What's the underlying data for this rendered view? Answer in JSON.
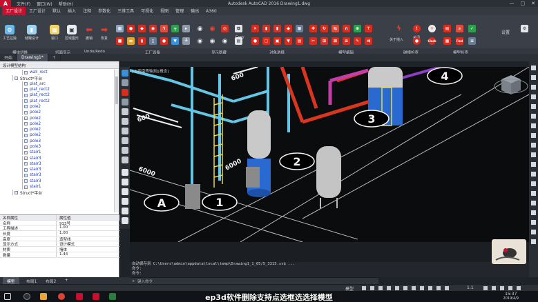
{
  "titlebar": {
    "logo": "A",
    "menus": [
      "文件(F)",
      "窗口(W)",
      "帮助(H)"
    ],
    "title": "Autodesk AutoCAD 2016   Drawing1.dwg",
    "controls": [
      "—",
      "□",
      "✕"
    ]
  },
  "ribbon_tabs": [
    "工厂设计",
    "工厂设计",
    "默认",
    "插入",
    "注释",
    "参数化",
    "三维工具",
    "可视化",
    "视图",
    "管理",
    "输出",
    "A360"
  ],
  "ribbon": {
    "buttons": [
      {
        "label": "工艺拉操",
        "icon": "gear-icon",
        "color": "#6bb7e8"
      },
      {
        "label": "储罐设计",
        "icon": "tank-icon",
        "color": "#9dd3f0"
      },
      {
        "label": "窗口",
        "icon": "window-icon",
        "color": "#f0d36b"
      },
      {
        "label": "区域图形",
        "icon": "region-icon",
        "color": "#e8eef5"
      },
      {
        "label": "撤销",
        "icon": "undo-icon",
        "color": "#e63b2e"
      },
      {
        "label": "恢复",
        "icon": "redo-icon",
        "color": "#e63b2e"
      }
    ],
    "groups": [
      "模块切换",
      "切面显示",
      "Undo/Redo",
      "工厂设备",
      "显示隐藏",
      "对象选择",
      "模型编辑",
      "碰撞检查",
      "模型检查"
    ],
    "copy_label": "Copy",
    "clash_label": "Clash",
    "find_label": "Find",
    "settings_label": "设置",
    "extra_label": "关闭",
    "misc_label": "关于插入"
  },
  "file_tabs": [
    {
      "label": "开始",
      "active": false
    },
    {
      "label": "Drawing1*",
      "active": true
    },
    {
      "label": "+",
      "active": false
    }
  ],
  "left_panel": {
    "title": "设计模型结构",
    "tree": [
      {
        "label": "wall_rect",
        "indent": 2
      },
      {
        "label": "Struct*平台",
        "indent": 1,
        "folder": true
      },
      {
        "label": "plat_arc",
        "indent": 2
      },
      {
        "label": "plat_rect2",
        "indent": 2
      },
      {
        "label": "plat_rect2",
        "indent": 2
      },
      {
        "label": "plat_rect2",
        "indent": 2
      },
      {
        "label": "pole2",
        "indent": 2
      },
      {
        "label": "pole2",
        "indent": 2
      },
      {
        "label": "pole2",
        "indent": 2
      },
      {
        "label": "pole2",
        "indent": 2
      },
      {
        "label": "pole2",
        "indent": 2
      },
      {
        "label": "pole2",
        "indent": 2
      },
      {
        "label": "pole3",
        "indent": 2
      },
      {
        "label": "pole3",
        "indent": 2
      },
      {
        "label": "stair1",
        "indent": 2
      },
      {
        "label": "stair3",
        "indent": 2
      },
      {
        "label": "stair3",
        "indent": 2
      },
      {
        "label": "stair3",
        "indent": 2
      },
      {
        "label": "stair3",
        "indent": 2
      },
      {
        "label": "stair3",
        "indent": 2
      },
      {
        "label": "stair1",
        "indent": 2
      },
      {
        "label": "Struct*平台",
        "indent": 1,
        "folder": true
      }
    ],
    "props_header": [
      "名称属性",
      "属性值"
    ],
    "props": [
      [
        "名称",
        "913号"
      ],
      [
        "工程描述",
        "1.00"
      ],
      [
        "长度",
        "1.00"
      ],
      [
        "高度",
        "造型线"
      ],
      [
        "显示方式",
        "设计模式"
      ],
      [
        "材质",
        "墙体"
      ],
      [
        "数量",
        "1.44"
      ]
    ]
  },
  "viewport": {
    "label": "[-][西南等轴测][概念]",
    "grid_labels": [
      "A",
      "1",
      "2",
      "3",
      "4"
    ],
    "dimension_labels": [
      "6000",
      "6000",
      "600",
      "600"
    ]
  },
  "command": {
    "lines": [
      "自动保存到 C:\\Users\\admin\\appdata\\local\\temp\\Drawing1_1_65/5_3315.sv$ ...",
      "命令:",
      "命令:"
    ],
    "placeholder": "键入命令"
  },
  "layout_tabs": [
    "模型",
    "布局1",
    "布局2",
    "+"
  ],
  "status": {
    "model": "模型",
    "scale": "1:1"
  },
  "taskbar": {
    "time": "15:37",
    "date": "2019/4/9"
  },
  "subtitle": "ep3d软件删除支持点选框选选择模型",
  "colors": {
    "accent": "#c8102e",
    "tree_text": "#1f3ab8"
  }
}
